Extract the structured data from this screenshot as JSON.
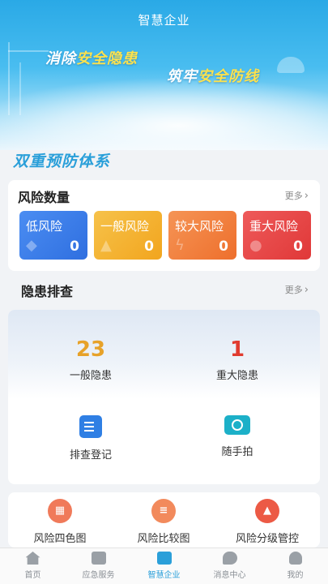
{
  "header": {
    "app_title": "智慧企业",
    "slogan_1_prefix": "消除",
    "slogan_1_highlight": "安全隐患",
    "slogan_2_prefix": "筑牢",
    "slogan_2_highlight": "安全防线"
  },
  "system_title": "双重预防体系",
  "risk_section": {
    "title": "风险数量",
    "more_label": "更多",
    "tiles": [
      {
        "label": "低风险",
        "count": "0",
        "color": "#3a7eea"
      },
      {
        "label": "一般风险",
        "count": "0",
        "color": "#f4b534"
      },
      {
        "label": "较大风险",
        "count": "0",
        "color": "#f08140"
      },
      {
        "label": "重大风险",
        "count": "0",
        "color": "#e64848"
      }
    ]
  },
  "hazard_section": {
    "title": "隐患排查",
    "more_label": "更多",
    "general_count": "23",
    "general_label": "一般隐患",
    "major_count": "1",
    "major_label": "重大隐患",
    "actions": [
      {
        "label": "排查登记",
        "icon": "form-edit-icon"
      },
      {
        "label": "随手拍",
        "icon": "camera-icon"
      }
    ]
  },
  "tools": [
    {
      "label": "风险四色图",
      "icon": "four-color-map-icon"
    },
    {
      "label": "风险比较图",
      "icon": "compare-chart-icon"
    },
    {
      "label": "风险分级管控",
      "icon": "grading-control-icon"
    }
  ],
  "tabbar": {
    "active": "智慧企业",
    "tabs": [
      {
        "label": "首页",
        "icon": "home-icon"
      },
      {
        "label": "应急服务",
        "icon": "emergency-service-icon"
      },
      {
        "label": "智慧企业",
        "icon": "enterprise-icon"
      },
      {
        "label": "消息中心",
        "icon": "message-icon"
      },
      {
        "label": "我的",
        "icon": "user-icon"
      }
    ]
  }
}
